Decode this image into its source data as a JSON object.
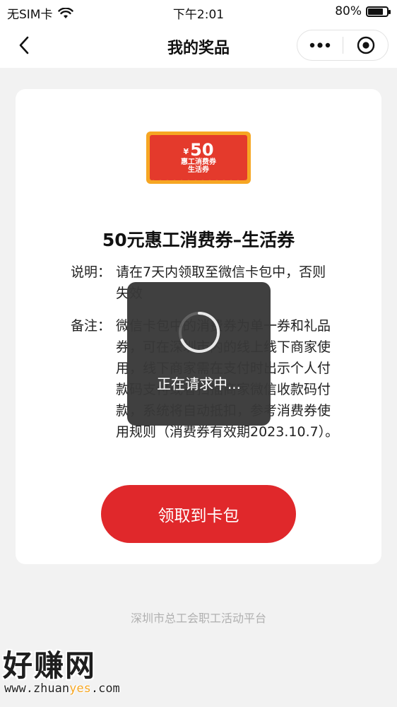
{
  "status_bar": {
    "carrier": "无SIM卡",
    "time": "下午2:01",
    "battery": "80%",
    "battery_level": 0.8,
    "wifi_icon": "wifi-icon",
    "battery_icon": "battery-icon"
  },
  "nav": {
    "title": "我的奖品",
    "back_icon": "chevron-left-icon",
    "more_icon": "more-dots-icon",
    "close_icon": "mini-program-close-icon"
  },
  "coupon": {
    "currency": "¥",
    "amount": "50",
    "line1": "惠工消费券",
    "line2": "生活券"
  },
  "prize": {
    "title": "50元惠工消费券–生活券",
    "desc_label": "说明：",
    "desc_text": "请在7天内领取至微信卡包中，否则失效",
    "remark_label": "备注：",
    "remark_text": "微信卡包中的消费券为单一券和礼品券，可在深圳市内的线上线下商家使用，线下商家需在支付时出示个人付款码支付或者扫描商家微信收款码付款，系统将自动抵扣，参考消费券使用规则（消费券有效期2023.10.7）。"
  },
  "claim_button": "领取到卡包",
  "footer": "深圳市总工会职工活动平台",
  "loading": {
    "text": "正在请求中...",
    "icon": "spinner-icon"
  },
  "watermark": {
    "title": "好赚网",
    "url_prefix": "www.zhuan",
    "url_accent": "yes",
    "url_suffix": ".com"
  },
  "colors": {
    "accent_red": "#e0282b",
    "coupon_orange": "#f6a623",
    "page_bg": "#f2f2f2"
  }
}
